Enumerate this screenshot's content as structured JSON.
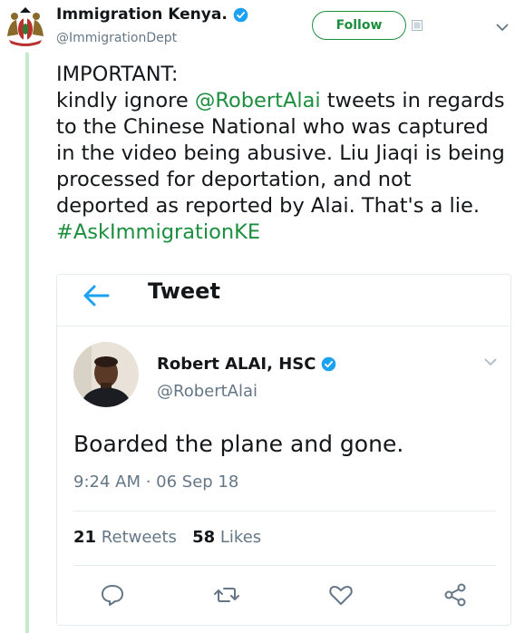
{
  "account": {
    "name": "Immigration Kenya.",
    "handle": "@ImmigrationDept",
    "follow_label": "Follow"
  },
  "tweet": {
    "line1": "IMPORTANT:",
    "line2_prefix": "kindly ignore ",
    "mention": "@RobertAlai",
    "line2_suffix": " tweets in regards to the Chinese National who was captured in the video being abusive. Liu Jiaqi is being processed for deportation, and not deported as reported by Alai. That's a lie. ",
    "hashtag": "#AskImmigrationKE"
  },
  "embedded": {
    "header_title": "Tweet",
    "author_name": "Robert ALAI, HSC",
    "author_handle": "@RobertAlai",
    "text": "Boarded the plane and gone.",
    "timestamp": "9:24 AM · 06 Sep 18",
    "retweets_count": "21",
    "retweets_label": "Retweets",
    "likes_count": "58",
    "likes_label": "Likes"
  },
  "icons": [
    "coat-of-arms-icon",
    "verified-icon",
    "chevron-down-icon",
    "back-arrow-icon",
    "reply-icon",
    "retweet-icon",
    "like-icon",
    "share-icon"
  ],
  "colors": {
    "accent": "#1c8f3f",
    "thread_line": "#c5ebcd",
    "verified": "#1da1f2",
    "app_blue": "#1da1f2",
    "secondary_text": "#657786"
  }
}
